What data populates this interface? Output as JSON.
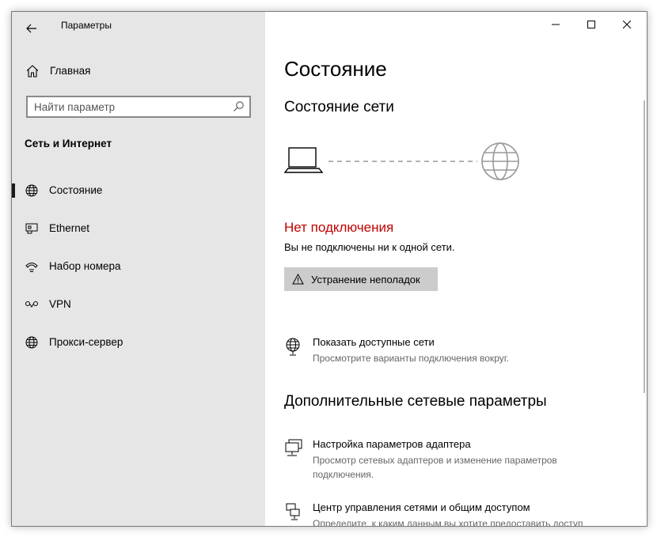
{
  "window": {
    "app_title": "Параметры",
    "controls": {
      "minimize": "—",
      "maximize": "☐",
      "close": "✕"
    }
  },
  "sidebar": {
    "home_label": "Главная",
    "search_placeholder": "Найти параметр",
    "section_title": "Сеть и Интернет",
    "items": [
      {
        "label": "Состояние",
        "icon": "globe-icon",
        "selected": true
      },
      {
        "label": "Ethernet",
        "icon": "ethernet-icon",
        "selected": false
      },
      {
        "label": "Набор номера",
        "icon": "dialup-icon",
        "selected": false
      },
      {
        "label": "VPN",
        "icon": "vpn-icon",
        "selected": false
      },
      {
        "label": "Прокси-сервер",
        "icon": "globe-icon",
        "selected": false
      }
    ]
  },
  "main": {
    "page_title": "Состояние",
    "network_status_heading": "Состояние сети",
    "status_title": "Нет подключения",
    "status_desc": "Вы не подключены ни к одной сети.",
    "troubleshoot_label": "Устранение неполадок",
    "show_networks": {
      "title": "Показать доступные сети",
      "desc": "Просмотрите варианты подключения вокруг."
    },
    "advanced_heading": "Дополнительные сетевые параметры",
    "adapter": {
      "title": "Настройка параметров адаптера",
      "desc": "Просмотр сетевых адаптеров и изменение параметров подключения."
    },
    "sharing_center": {
      "title": "Центр управления сетями и общим доступом",
      "desc": "Определите, к каким данным вы хотите предоставить доступ"
    }
  },
  "colors": {
    "sidebar_bg": "#e6e6e6",
    "error_red": "#c00000",
    "button_bg": "#cccccc",
    "secondary_text": "#666666"
  }
}
